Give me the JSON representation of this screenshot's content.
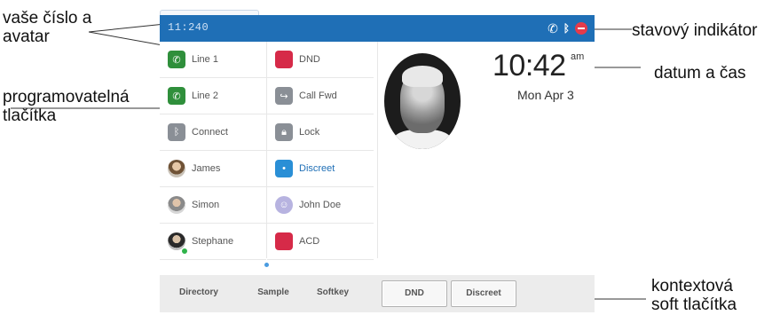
{
  "callouts": {
    "number_avatar": [
      "vaše číslo a",
      "avatar"
    ],
    "programmable": [
      "programovatelná",
      "tlačítka"
    ],
    "status": "stavový indikátor",
    "datetime": "datum a čas",
    "softkeys": [
      "kontextová",
      "soft tlačítka"
    ]
  },
  "status_bar": {
    "number": "11:240",
    "icons": [
      "phone-icon",
      "bluetooth-icon",
      "dnd-icon"
    ],
    "phone_glyph": "✆",
    "bt_glyph": "ᛒ",
    "accent": "#1f6fb6"
  },
  "keys_left": [
    {
      "label": "Line 1",
      "icon": "phone-icon",
      "glyph": "✆",
      "type": "green"
    },
    {
      "label": "Line 2",
      "icon": "phone-icon",
      "glyph": "✆",
      "type": "green"
    },
    {
      "label": "Connect",
      "icon": "bluetooth-icon",
      "glyph": "ᛒ",
      "type": "grey"
    },
    {
      "label": "James",
      "icon": "contact-avatar-icon",
      "glyph": "",
      "type": "avatar"
    },
    {
      "label": "Simon",
      "icon": "contact-avatar-icon",
      "glyph": "",
      "type": "avatar-grey"
    },
    {
      "label": "Stephane",
      "icon": "contact-avatar-icon",
      "glyph": "",
      "type": "avatar-dark"
    }
  ],
  "keys_right": [
    {
      "label": "DND",
      "icon": "dnd-icon",
      "glyph": "",
      "type": "red"
    },
    {
      "label": "Call Fwd",
      "icon": "call-forward-icon",
      "glyph": "↪",
      "type": "grey"
    },
    {
      "label": "Lock",
      "icon": "lock-icon",
      "glyph": "🔒︎",
      "type": "grey"
    },
    {
      "label": "Discreet",
      "icon": "discreet-icon",
      "glyph": "•",
      "type": "blue"
    },
    {
      "label": "John Doe",
      "icon": "contact-placeholder-icon",
      "glyph": "☺",
      "type": "lav"
    },
    {
      "label": "ACD",
      "icon": "acd-icon",
      "glyph": "",
      "type": "red"
    }
  ],
  "clock": {
    "time": "10:42",
    "ampm": "am",
    "date": "Mon Apr 3"
  },
  "softkeys": [
    {
      "label": "Directory",
      "boxed": false
    },
    {
      "label": "Sample",
      "boxed": false
    },
    {
      "label": "Softkey",
      "boxed": false
    },
    {
      "label": "DND",
      "boxed": true
    },
    {
      "label": "Discreet",
      "boxed": true
    }
  ]
}
